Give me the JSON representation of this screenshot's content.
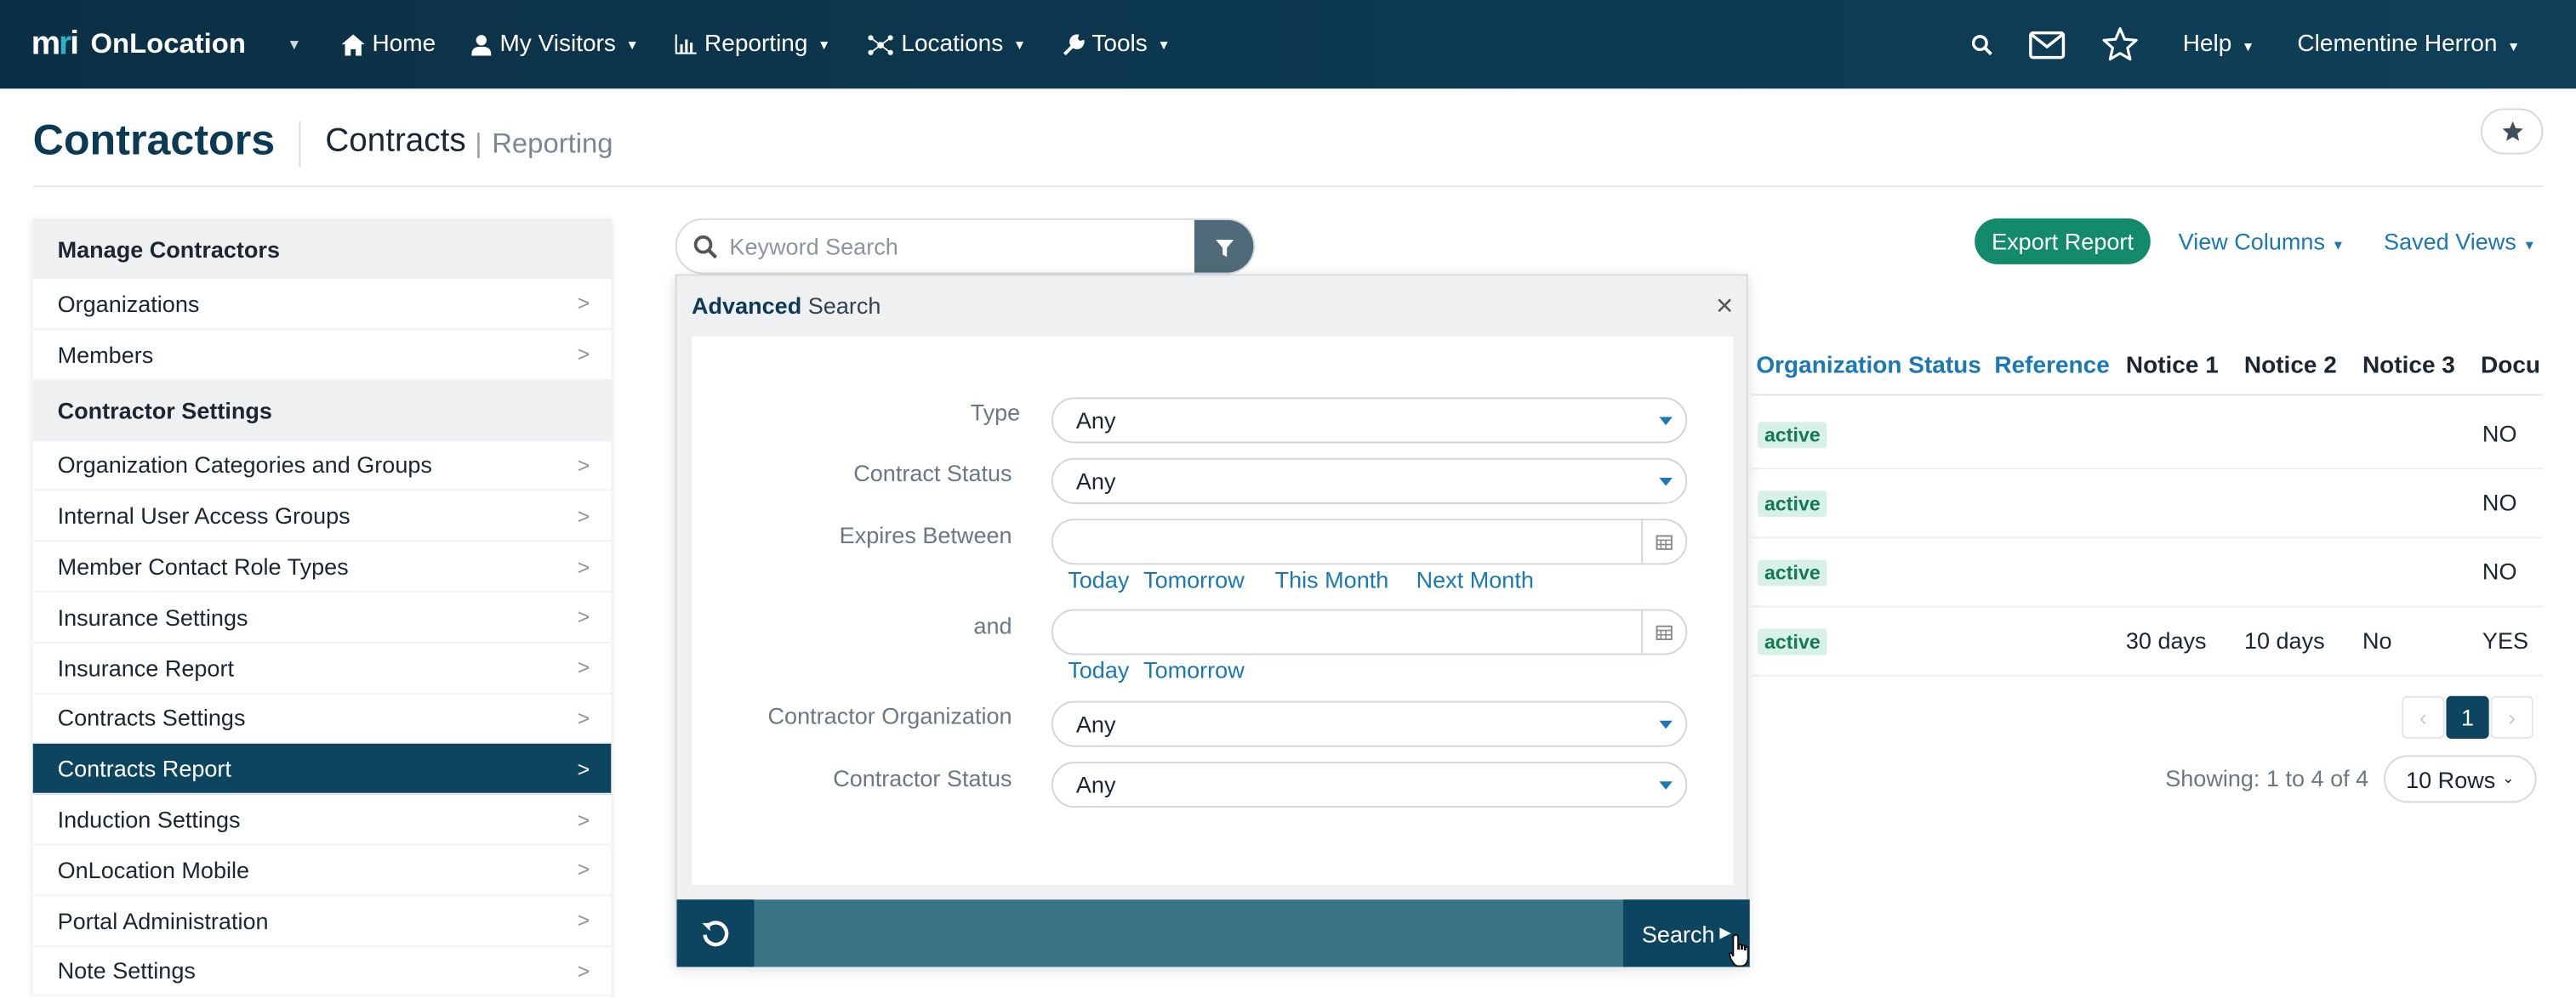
{
  "nav": {
    "brand_mark": "mri",
    "brand_product": "OnLocation",
    "items": [
      {
        "label": "Home",
        "icon": "home-icon"
      },
      {
        "label": "My Visitors",
        "icon": "user-icon"
      },
      {
        "label": "Reporting",
        "icon": "chart-icon"
      },
      {
        "label": "Locations",
        "icon": "network-icon"
      },
      {
        "label": "Tools",
        "icon": "wrench-icon"
      }
    ],
    "help_label": "Help",
    "user_name": "Clementine Herron"
  },
  "header": {
    "title": "Contractors",
    "subtitle": "Contracts",
    "subtitle_secondary": "Reporting"
  },
  "sidebar": {
    "sections": [
      {
        "title": "Manage Contractors",
        "items": [
          "Organizations",
          "Members"
        ]
      },
      {
        "title": "Contractor Settings",
        "items": [
          "Organization Categories and Groups",
          "Internal User Access Groups",
          "Member Contact Role Types",
          "Insurance Settings",
          "Insurance Report",
          "Contracts Settings",
          "Contracts Report",
          "Induction Settings",
          "OnLocation Mobile",
          "Portal Administration",
          "Note Settings"
        ]
      }
    ],
    "active_item": "Contracts Report"
  },
  "search": {
    "placeholder": "Keyword Search"
  },
  "toolbar": {
    "export_label": "Export Report",
    "view_columns_label": "View Columns",
    "saved_views_label": "Saved Views"
  },
  "table": {
    "columns": [
      "Organization Status",
      "Reference",
      "Notice 1",
      "Notice 2",
      "Notice 3",
      "Docu"
    ],
    "rows": [
      {
        "status": "active",
        "reference": "",
        "notice1": "",
        "notice2": "",
        "notice3": "",
        "docu": "NO"
      },
      {
        "status": "active",
        "reference": "",
        "notice1": "",
        "notice2": "",
        "notice3": "",
        "docu": "NO"
      },
      {
        "status": "active",
        "reference": "",
        "notice1": "",
        "notice2": "",
        "notice3": "",
        "docu": "NO"
      },
      {
        "status": "active",
        "reference": "",
        "notice1": "30 days",
        "notice2": "10 days",
        "notice3": "No",
        "docu": "YES"
      }
    ]
  },
  "pagination": {
    "prev": "‹",
    "current": "1",
    "next": "›",
    "showing": "Showing: 1 to 4 of 4",
    "rows_label": "10 Rows"
  },
  "advanced_search": {
    "title_bold": "Advanced",
    "title_rest": "Search",
    "fields": {
      "type_label": "Type",
      "type_value": "Any",
      "contract_status_label": "Contract Status",
      "contract_status_value": "Any",
      "expires_between_label": "Expires Between",
      "and_label": "and",
      "contractor_org_label": "Contractor Organization",
      "contractor_org_value": "Any",
      "contractor_status_label": "Contractor Status",
      "contractor_status_value": "Any"
    },
    "quick_links_1": [
      "Today",
      "Tomorrow",
      "This Month",
      "Next Month"
    ],
    "quick_links_2": [
      "Today",
      "Tomorrow"
    ],
    "search_button": "Search"
  },
  "colors": {
    "nav_bg": "#0b3045",
    "accent": "#1a78b4",
    "active_sidebar": "#0d4561",
    "export_green": "#138a6b",
    "footer_bar": "#3a7383"
  }
}
